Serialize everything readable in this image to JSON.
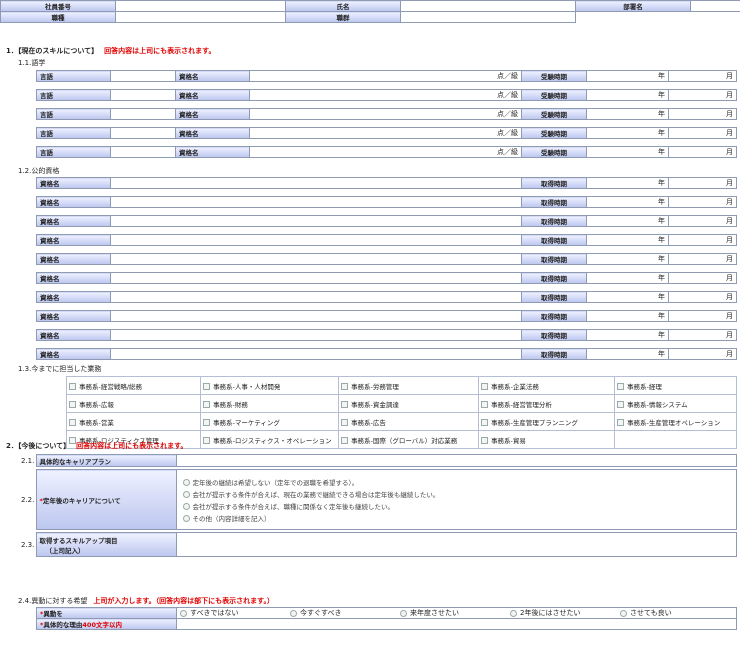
{
  "header": {
    "employee_no_label": "社員番号",
    "name_label": "氏名",
    "dept_label": "部署名",
    "position_label": "職種",
    "grade_label": "職群"
  },
  "section1": {
    "title": "1．【現在のスキルについて】",
    "note": "回答内容は上司にも表示されます。",
    "s11_title": "1.1.語学",
    "language_rows": [
      {
        "lang": "言語",
        "qual": "資格名",
        "score": "点／級",
        "date": "受験時期",
        "year": "年",
        "month": "月"
      },
      {
        "lang": "言語",
        "qual": "資格名",
        "score": "点／級",
        "date": "受験時期",
        "year": "年",
        "month": "月"
      },
      {
        "lang": "言語",
        "qual": "資格名",
        "score": "点／級",
        "date": "受験時期",
        "year": "年",
        "month": "月"
      },
      {
        "lang": "言語",
        "qual": "資格名",
        "score": "点／級",
        "date": "受験時期",
        "year": "年",
        "month": "月"
      },
      {
        "lang": "言語",
        "qual": "資格名",
        "score": "点／級",
        "date": "受験時期",
        "year": "年",
        "month": "月"
      }
    ],
    "s12_title": "1.2.公的資格",
    "qual_rows": [
      {
        "qual": "資格名",
        "date": "取得時期",
        "year": "年",
        "month": "月"
      },
      {
        "qual": "資格名",
        "date": "取得時期",
        "year": "年",
        "month": "月"
      },
      {
        "qual": "資格名",
        "date": "取得時期",
        "year": "年",
        "month": "月"
      },
      {
        "qual": "資格名",
        "date": "取得時期",
        "year": "年",
        "month": "月"
      },
      {
        "qual": "資格名",
        "date": "取得時期",
        "year": "年",
        "month": "月"
      },
      {
        "qual": "資格名",
        "date": "取得時期",
        "year": "年",
        "month": "月"
      },
      {
        "qual": "資格名",
        "date": "取得時期",
        "year": "年",
        "month": "月"
      },
      {
        "qual": "資格名",
        "date": "取得時期",
        "year": "年",
        "month": "月"
      },
      {
        "qual": "資格名",
        "date": "取得時期",
        "year": "年",
        "month": "月"
      },
      {
        "qual": "資格名",
        "date": "取得時期",
        "year": "年",
        "month": "月"
      }
    ],
    "s13_title": "1.3.今までに担当した業務",
    "duties": [
      [
        "事務系-経営戦略/総務",
        "事務系-人事・人材開発",
        "事務系-労務管理",
        "事務系-企業法務",
        "事務系-経理"
      ],
      [
        "事務系-広報",
        "事務系-財務",
        "事務系-資金調達",
        "事務系-経営管理分析",
        "事務系-情報システム"
      ],
      [
        "事務系-営業",
        "事務系-マーケティング",
        "事務系-広告",
        "事務系-生産管理プランニング",
        "事務系-生産管理オペレーション"
      ],
      [
        "事務系-ロジスティクス管理",
        "事務系-ロジスティクス・オペレーション",
        "事務系-国際（グローバル）対応業務",
        "事務系-貿易",
        ""
      ]
    ]
  },
  "section2": {
    "title": "2．【今後について】",
    "note": "回答内容は上司にも表示されます。",
    "r21_num": "2.1.",
    "r21_label": "具体的なキャリアプラン",
    "r22_num": "2.2.",
    "r22_star": "*",
    "r22_label": "定年後のキャリアについて",
    "r22_options": [
      "定年後の継続は希望しない（定年での退職を希望する）。",
      "会社が提示する条件が合えば、現在の業務で継続できる場合は定年後も継続したい。",
      "会社が提示する条件が合えば、職種に関係なく定年後も継続したい。",
      "その他（内容詳細を記入）"
    ],
    "r23_num": "2.3.",
    "r23_label": "取得するスキルアップ項目",
    "r23_sub": "（上司記入）",
    "s24_title": "2.4.異動に対する希望",
    "s24_note": "上司が入力します。（回答内容は部下にも表示されます。）",
    "r24a_star": "*",
    "r24a_label": "異動を",
    "r24a_options": [
      "すべきではない",
      "今すぐすべき",
      "来年度させたい",
      "2年後にはさせたい",
      "させても良い"
    ],
    "r24b_star": "*",
    "r24b_label": "具体的な理由",
    "r24b_suffix": "400文字以内"
  }
}
